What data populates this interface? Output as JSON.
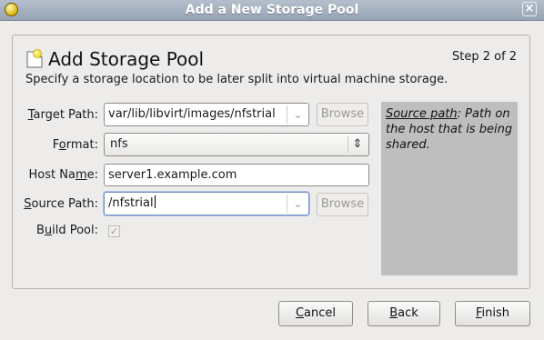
{
  "window": {
    "title": "Add a New Storage Pool",
    "close_glyph": "×"
  },
  "header": {
    "title": "Add Storage Pool",
    "step": "Step 2 of 2",
    "description": "Specify a storage location to be later split into virtual machine storage."
  },
  "form": {
    "target_path": {
      "label_mnemonic": "T",
      "label_rest": "arget Path:",
      "value": "var/lib/libvirt/images/nfstrial",
      "browse": "Browse",
      "arrow": "⌄"
    },
    "format": {
      "label_pre": "F",
      "label_mnemonic": "o",
      "label_rest": "rmat:",
      "value": "nfs",
      "updown": "⇕"
    },
    "host_name": {
      "label_pre": "Host Na",
      "label_mnemonic": "m",
      "label_rest": "e:",
      "value": "server1.example.com"
    },
    "source_path": {
      "label_mnemonic": "S",
      "label_rest": "ource Path:",
      "value": "/nfstrial",
      "browse": "Browse",
      "arrow": "⌄"
    },
    "build_pool": {
      "label_pre": "B",
      "label_mnemonic": "u",
      "label_rest": "ild Pool:",
      "checked": true,
      "check_glyph": "✓"
    }
  },
  "help": {
    "term": "Source path",
    "text": ": Path on the host that is being shared."
  },
  "buttons": {
    "cancel": {
      "mnemonic": "C",
      "rest": "ancel"
    },
    "back": {
      "mnemonic": "B",
      "rest": "ack"
    },
    "finish": {
      "mnemonic": "F",
      "rest": "inish"
    }
  },
  "colors": {
    "titlebar": "#a6b1bf",
    "help_panel": "#bebebe",
    "background": "#edeceb"
  }
}
